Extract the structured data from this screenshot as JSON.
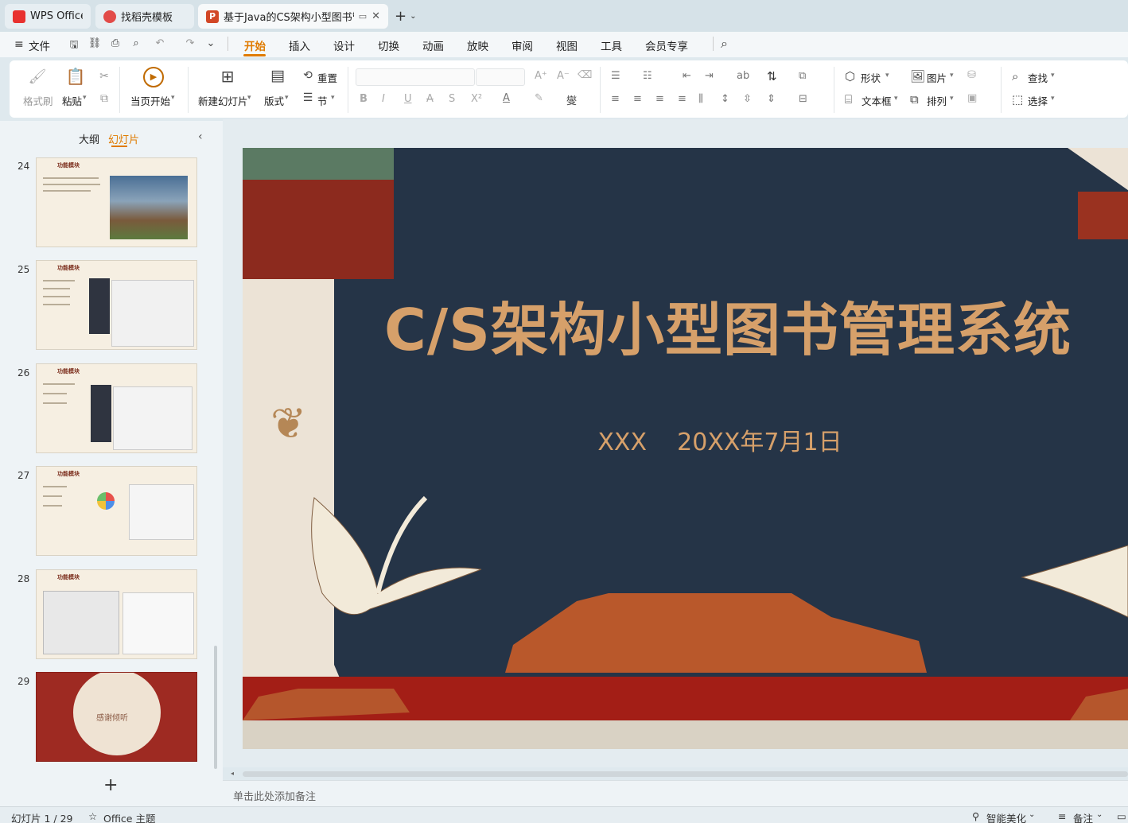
{
  "tabs": [
    {
      "label": "WPS Office",
      "icon": "wps-logo-icon"
    },
    {
      "label": "找稻壳模板",
      "icon": "docer-icon"
    },
    {
      "label": "基于Java的CS架构小型图书管",
      "icon": "ppt-file-icon"
    }
  ],
  "menu": [
    "文件",
    "开始",
    "插入",
    "设计",
    "切换",
    "动画",
    "放映",
    "审阅",
    "视图",
    "工具",
    "会员专享"
  ],
  "ribbon": {
    "format_painter": "格式刷",
    "paste": "粘贴",
    "from_current": "当页开始",
    "new_slide": "新建幻灯片",
    "layout": "版式",
    "reset": "重置",
    "section": "节",
    "shape": "形状",
    "picture": "图片",
    "textbox": "文本框",
    "arrange": "排列",
    "find": "查找",
    "select": "选择"
  },
  "panel": {
    "outline_tab": "大纲",
    "slides_tab": "幻灯片"
  },
  "thumbnails": [
    {
      "number": "24",
      "header": "功能模块"
    },
    {
      "number": "25",
      "header": "功能模块"
    },
    {
      "number": "26",
      "header": "功能模块"
    },
    {
      "number": "27",
      "header": "功能模块"
    },
    {
      "number": "28",
      "header": "功能模块"
    },
    {
      "number": "29",
      "text": "感谢倾听"
    }
  ],
  "slide": {
    "title": "C/S架构小型图书管理系统",
    "subtitle": "XXX    20XX年7月1日"
  },
  "notes_placeholder": "单击此处添加备注",
  "status": {
    "slide_indicator": "幻灯片 1 / 29",
    "theme": "Office 主题",
    "smart_beautify": "智能美化",
    "notes": "备注"
  },
  "colors": {
    "accent": "#e07b00",
    "slide_navy": "#253447",
    "slide_gold": "#d6a06a",
    "ppt_red": "#d24726"
  }
}
